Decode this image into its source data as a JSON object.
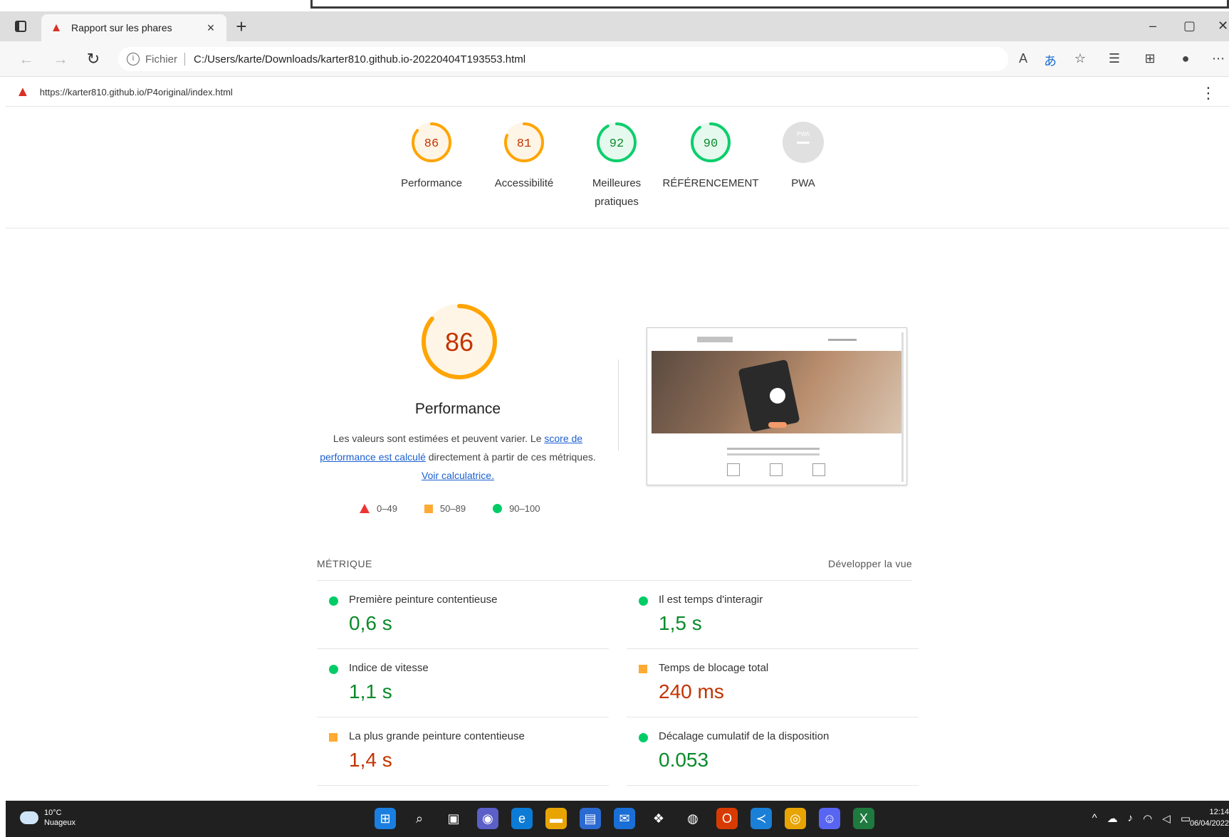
{
  "browser": {
    "tab_title": "Rapport sur les phares",
    "tab_close": "×",
    "new_tab": "+",
    "address_label": "Fichier",
    "address_url": "C:/Users/karte/Downloads/karter810.github.io-20220404T193553.html",
    "win_minimize": "–",
    "win_restore": "▢",
    "win_close": "✕"
  },
  "report": {
    "page_url": "https://karter810.github.io/P4original/index.html",
    "categories": [
      {
        "label": "Performance",
        "score": "86",
        "status": "orange"
      },
      {
        "label": "Accessibilité",
        "score": "81",
        "status": "orange"
      },
      {
        "label": "Meilleures pratiques",
        "score": "92",
        "status": "green"
      },
      {
        "label": "RÉFÉRENCEMENT",
        "score": "90",
        "status": "green"
      },
      {
        "label": "PWA",
        "score": "",
        "status": "gray"
      }
    ],
    "pwa_badge": "PWA",
    "performance": {
      "score": "86",
      "title": "Performance",
      "desc_prefix": "Les valeurs sont estimées et peuvent varier. Le ",
      "desc_link1": "score de performance est calculé",
      "desc_mid": " directement à partir de ces métriques. ",
      "desc_link2": "Voir calculatrice."
    },
    "legend": [
      {
        "range": "0–49"
      },
      {
        "range": "50–89"
      },
      {
        "range": "90–100"
      }
    ],
    "metrics_header": "MÉTRIQUE",
    "expand_view": "Développer la vue",
    "metrics": [
      {
        "name": "Première peinture contentieuse",
        "value": "0,6 s",
        "status": "green"
      },
      {
        "name": "Il est temps d'interagir",
        "value": "1,5 s",
        "status": "green"
      },
      {
        "name": "Indice de vitesse",
        "value": "1,1 s",
        "status": "green"
      },
      {
        "name": "Temps de blocage total",
        "value": "240 ms",
        "status": "orange"
      },
      {
        "name": "La plus grande peinture contentieuse",
        "value": "1,4 s",
        "status": "orange"
      },
      {
        "name": "Décalage cumulatif de la disposition",
        "value": "0.053",
        "status": "green"
      }
    ]
  },
  "taskbar": {
    "temperature": "10°C",
    "weather": "Nuageux",
    "time": "12:14",
    "date": "06/04/2022"
  },
  "colors": {
    "orange": "#ffa400",
    "green": "#0cce6b",
    "gray": "#e0e0e0"
  }
}
